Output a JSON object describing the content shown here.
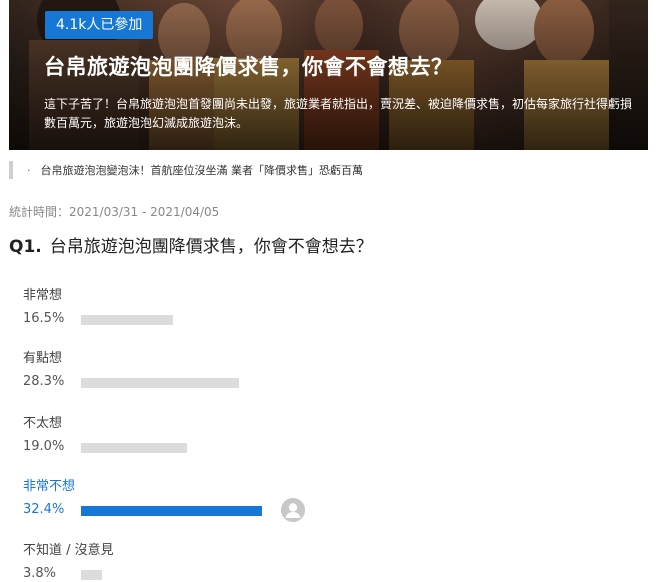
{
  "hero": {
    "badge": "4.1k人已參加",
    "title": "台帛旅遊泡泡團降價求售，你會不會想去？",
    "description": "這下子苦了！台帛旅遊泡泡首發團尚未出發，旅遊業者就指出，賣況差、被迫降價求售，初估每家旅行社得虧損數百萬元，旅遊泡泡幻滅成旅遊泡沫。"
  },
  "related": {
    "bullet": "·",
    "text": "台帛旅遊泡泡變泡沫！首航座位沒坐滿 業者「降價求售」恐虧百萬"
  },
  "period": "統計時間：2021/03/31 - 2021/04/05",
  "question": {
    "number": "Q1.",
    "text": "台帛旅遊泡泡團降價求售，你會不會想去？"
  },
  "options": [
    {
      "label": "非常想",
      "percent_text": "16.5%",
      "value": 16.5,
      "selected": false
    },
    {
      "label": "有點想",
      "percent_text": "28.3%",
      "value": 28.3,
      "selected": false
    },
    {
      "label": "不太想",
      "percent_text": "19.0%",
      "value": 19.0,
      "selected": false
    },
    {
      "label": "非常不想",
      "percent_text": "32.4%",
      "value": 32.4,
      "selected": true
    },
    {
      "label": "不知道 / 沒意見",
      "percent_text": "3.8%",
      "value": 3.8,
      "selected": false
    }
  ],
  "colors": {
    "accent": "#1677d6",
    "bar_unselected": "#dcdcdc",
    "period_text": "#888888"
  },
  "icons": {
    "voter_avatar": "user-avatar-icon"
  }
}
